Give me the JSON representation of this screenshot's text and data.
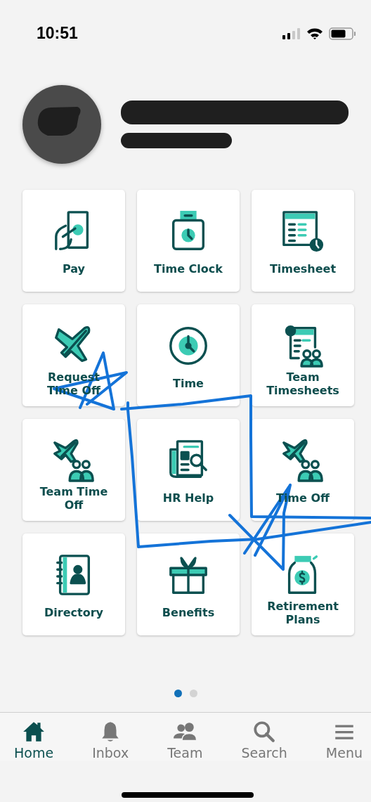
{
  "status_bar": {
    "time": "10:51"
  },
  "tiles": [
    {
      "label": "Pay"
    },
    {
      "label": "Time Clock"
    },
    {
      "label": "Timesheet"
    },
    {
      "label": "Request Time Off"
    },
    {
      "label": "Time"
    },
    {
      "label": "Team Timesheets"
    },
    {
      "label": "Team Time Off"
    },
    {
      "label": "HR Help"
    },
    {
      "label": "Time Off"
    },
    {
      "label": "Directory"
    },
    {
      "label": "Benefits"
    },
    {
      "label": "Retirement Plans"
    }
  ],
  "page_dots": [
    {
      "selected": true
    },
    {
      "selected": false
    }
  ],
  "nav": [
    {
      "label": "Home",
      "selected": true
    },
    {
      "label": "Inbox",
      "selected": false
    },
    {
      "label": "Team",
      "selected": false
    },
    {
      "label": "Search",
      "selected": false
    },
    {
      "label": "Menu",
      "selected": false
    }
  ]
}
